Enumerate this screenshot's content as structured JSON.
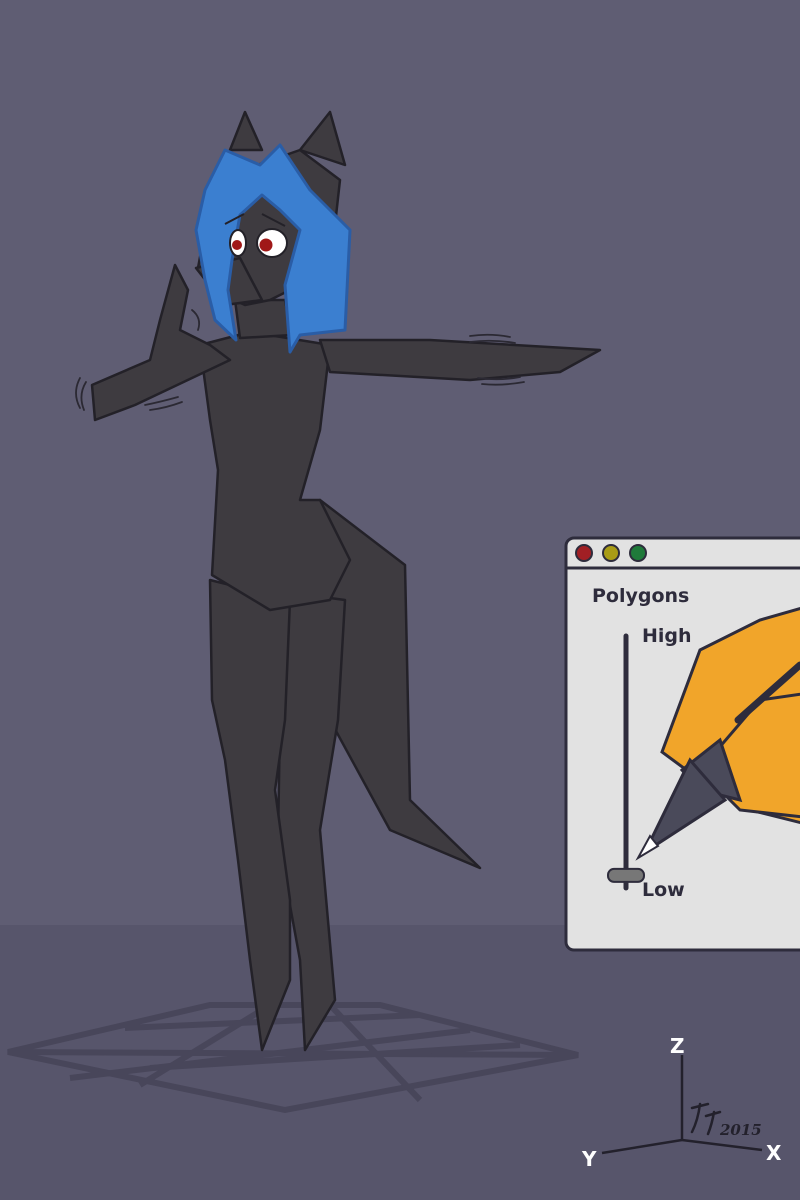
{
  "scene": {
    "description_free": true,
    "colors": {
      "wall": "#5f5d73",
      "floor": "#56546a",
      "grid": "#4a485c",
      "body": "#3e3b40",
      "hair": "#3b7fd0",
      "hair_edge": "#2a5da6",
      "eye": "#a01818",
      "window_bg": "#e2e2e2",
      "window_frame": "#2e2c3c",
      "btn_red": "#a11f24",
      "btn_yellow": "#a99c16",
      "btn_green": "#1f7a3a",
      "pencil_orange": "#f1a52a",
      "pencil_dark": "#4a4a5a"
    }
  },
  "window": {
    "title": "Polygons",
    "buttons": [
      "close-button",
      "minimize-button",
      "maximize-button"
    ],
    "slider": {
      "high_label": "High",
      "low_label": "Low",
      "value": 0.05
    }
  },
  "axes": {
    "z_label": "Z",
    "y_label": "Y",
    "x_label": "X"
  },
  "signature": {
    "year": "2015"
  }
}
